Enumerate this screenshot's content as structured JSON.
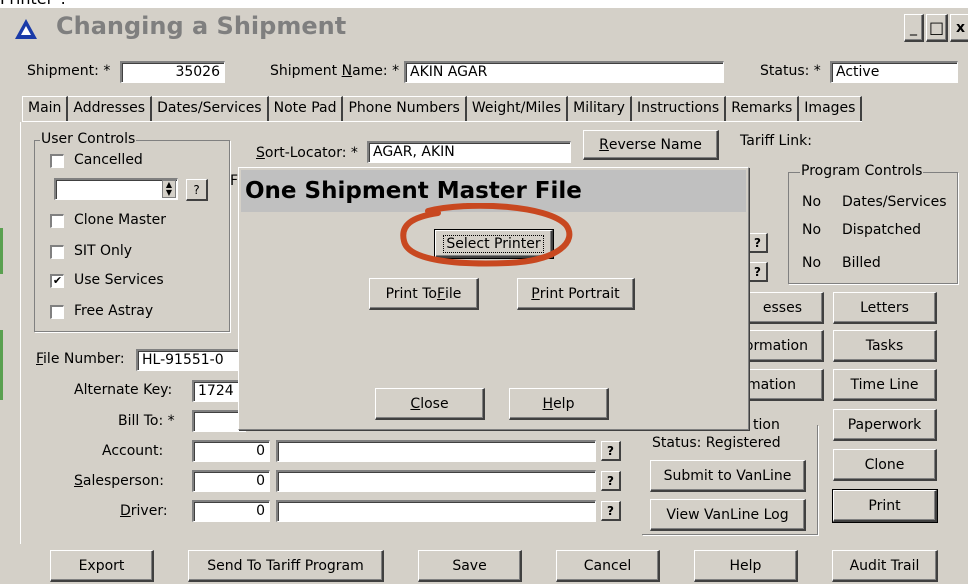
{
  "top_strip_text": "Printer\".",
  "window": {
    "title": "Changing a Shipment",
    "controls": {
      "minimize": "_",
      "maximize": "□",
      "close": "x"
    }
  },
  "header": {
    "shipment_label": "Shipment: *",
    "shipment_value": "35026",
    "shipment_name_label_pre": "Shipment ",
    "shipment_name_label_u": "N",
    "shipment_name_label_post": "ame: *",
    "shipment_name_value": "AKIN AGAR",
    "status_label": "Status: *",
    "status_value": "Active"
  },
  "tabs": [
    "Main",
    "Addresses",
    "Dates/Services",
    "Note Pad",
    "Phone Numbers",
    "Weight/Miles",
    "Military",
    "Instructions",
    "Remarks",
    "Images"
  ],
  "user_controls": {
    "title": "User Controls",
    "items": [
      {
        "label": "Cancelled",
        "checked": ""
      },
      {
        "label": "Clone Master",
        "checked": ""
      },
      {
        "label": "SIT Only",
        "checked": ""
      },
      {
        "label": "Use Services",
        "checked": "✔"
      },
      {
        "label": "Free Astray",
        "checked": ""
      }
    ],
    "spin_help": "?"
  },
  "sort_locator": {
    "label_u": "S",
    "label_post": "ort-Locator: *",
    "value": "AGAR, AKIN",
    "reverse_button_u": "R",
    "reverse_button_post": "everse Name",
    "partial_letter": "F"
  },
  "tariff_link_label": "Tariff Link:",
  "program_controls": {
    "title": "Program Controls",
    "rows": [
      {
        "flag": "No",
        "label": "Dates/Services"
      },
      {
        "flag": "No",
        "label": "Dispatched"
      },
      {
        "flag": "No",
        "label": "Billed"
      }
    ]
  },
  "fields": {
    "file_number_label_u": "F",
    "file_number_label_post": "ile Number:",
    "file_number_value": "HL-91551-0",
    "alternate_key_label": "Alternate Key:",
    "alternate_key_value": "1724",
    "bill_to_label": "Bill To: *",
    "account_label": "Account:",
    "account_value": "0",
    "salesperson_label_u": "S",
    "salesperson_label_post": "alesperson:",
    "salesperson_value": "0",
    "driver_label_u": "D",
    "driver_label_post": "river:",
    "driver_value": "0",
    "help_q": "?"
  },
  "partial_buttons": {
    "addresses": "esses",
    "information1": "ormation",
    "information2": "mation",
    "registration_title": "tion"
  },
  "vanline": {
    "status_text": "Status:  Registered",
    "submit_button": "Submit to VanLine",
    "view_log_button": "View VanLine Log"
  },
  "right_buttons": {
    "letters": "Letters",
    "tasks": "Tasks",
    "time_line": "Time Line",
    "paperwork": "Paperwork",
    "clone": "Clone",
    "print": "Print"
  },
  "bottom_buttons": {
    "export": "Export",
    "send_to_tariff": "Send To Tariff Program",
    "save": "Save",
    "cancel": "Cancel",
    "help": "Help",
    "audit_trail": "Audit Trail"
  },
  "dialog": {
    "title": "One Shipment Master File",
    "select_printer": "Select Printer",
    "print_to_file_pre": "Print To ",
    "print_to_file_u": "F",
    "print_to_file_post": "ile",
    "print_portrait_u": "P",
    "print_portrait_post": "rint Portrait",
    "close_u": "C",
    "close_post": "lose",
    "help_u": "H",
    "help_post": "elp"
  },
  "colors": {
    "window_bg": "#d4d0c8",
    "annotation_circle": "#c84820",
    "title_text": "#7f7f7f",
    "icon_blue": "#1a3aa8",
    "left_edge_green": "#5aa050"
  }
}
